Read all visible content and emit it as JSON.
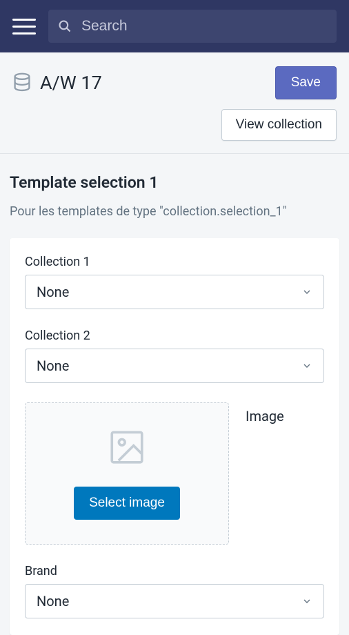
{
  "topbar": {
    "search_placeholder": "Search"
  },
  "header": {
    "title": "A/W 17",
    "save_label": "Save",
    "view_label": "View collection"
  },
  "section": {
    "title": "Template selection 1",
    "subtitle": "Pour les templates de type \"collection.selection_1\""
  },
  "fields": {
    "collection1": {
      "label": "Collection 1",
      "value": "None"
    },
    "collection2": {
      "label": "Collection 2",
      "value": "None"
    },
    "image": {
      "label": "Image",
      "button": "Select image"
    },
    "brand": {
      "label": "Brand",
      "value": "None"
    }
  }
}
